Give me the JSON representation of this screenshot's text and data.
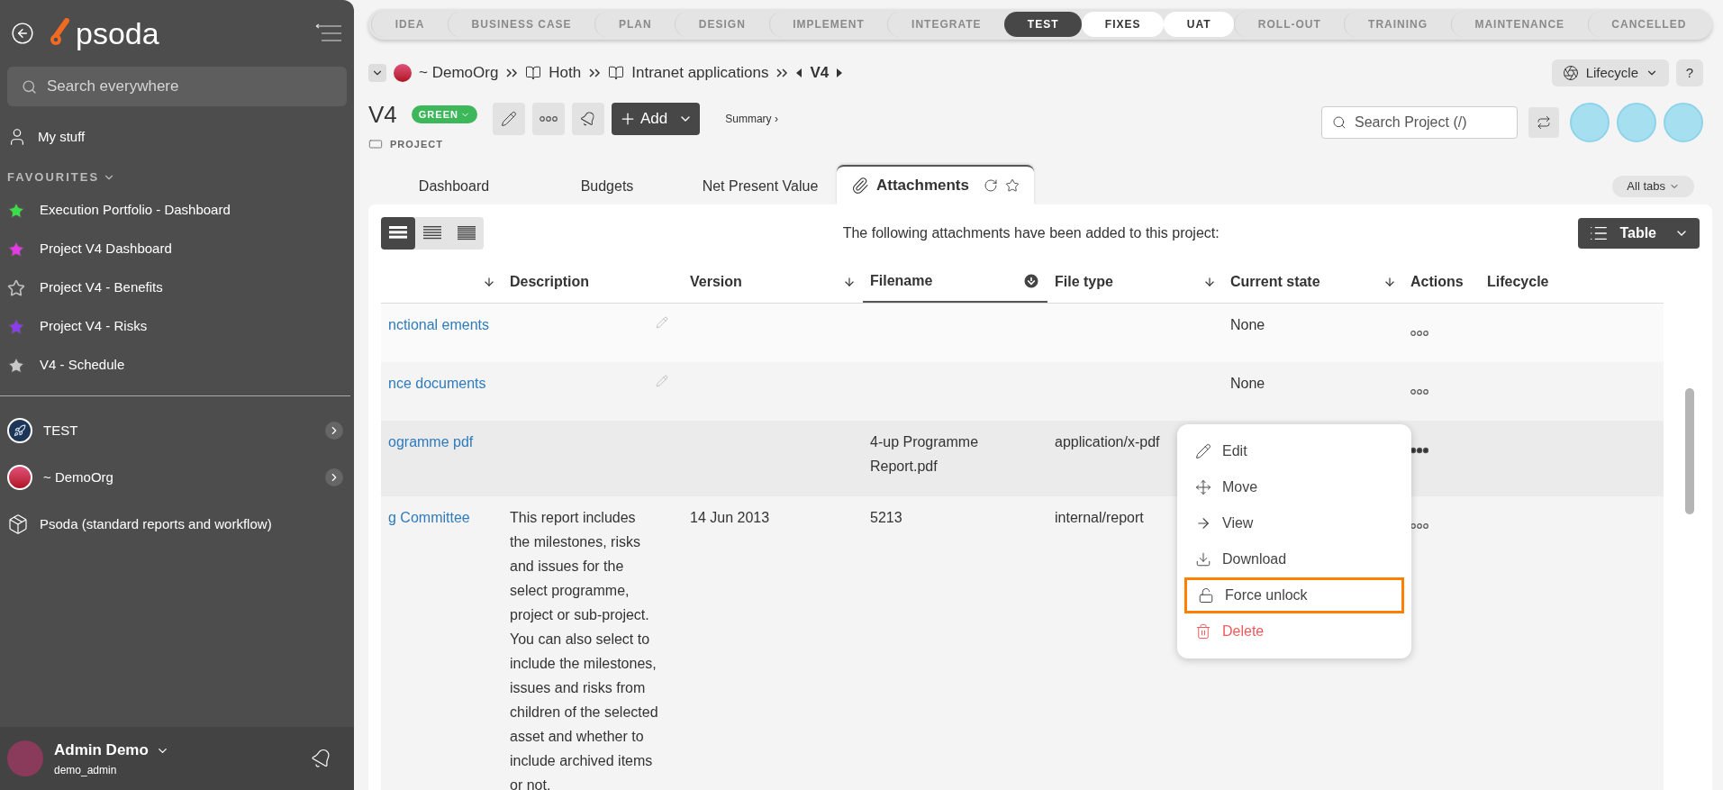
{
  "sidebar": {
    "logo": "psoda",
    "search": {
      "placeholder": "Search everywhere"
    },
    "my_stuff": "My stuff",
    "favourites_heading": "FAVOURITES",
    "favourites": [
      {
        "label": "Execution Portfolio - Dashboard",
        "color": "#3ddc4a",
        "filled": true
      },
      {
        "label": "Project V4 Dashboard",
        "color": "#e03ce0",
        "filled": true
      },
      {
        "label": "Project V4 - Benefits",
        "color": "#bdbdbd",
        "filled": false
      },
      {
        "label": "Project V4 - Risks",
        "color": "#8a3ee8",
        "filled": true
      },
      {
        "label": "V4 - Schedule",
        "color": "#c8c8c8",
        "filled": true
      }
    ],
    "items": [
      {
        "label": "TEST",
        "kind": "rocket",
        "expandable": true
      },
      {
        "label": "~ DemoOrg",
        "kind": "org",
        "expandable": true
      },
      {
        "label": "Psoda (standard reports and workflow)",
        "kind": "package",
        "expandable": false
      }
    ],
    "user": {
      "name": "Admin Demo",
      "login": "demo_admin"
    }
  },
  "stages": [
    {
      "label": "IDEA",
      "kind": "default"
    },
    {
      "label": "BUSINESS CASE",
      "kind": "default"
    },
    {
      "label": "PLAN",
      "kind": "default"
    },
    {
      "label": "DESIGN",
      "kind": "default"
    },
    {
      "label": "IMPLEMENT",
      "kind": "default"
    },
    {
      "label": "INTEGRATE",
      "kind": "default"
    },
    {
      "label": "TEST",
      "kind": "active"
    },
    {
      "label": "FIXES",
      "kind": "upcoming"
    },
    {
      "label": "UAT",
      "kind": "upcoming"
    },
    {
      "label": "ROLL-OUT",
      "kind": "default"
    },
    {
      "label": "TRAINING",
      "kind": "default"
    },
    {
      "label": "MAINTENANCE",
      "kind": "default"
    },
    {
      "label": "CANCELLED",
      "kind": "default"
    }
  ],
  "breadcrumb": [
    {
      "label": "~ DemoOrg",
      "kind": "org"
    },
    {
      "label": "Hoth",
      "kind": "book"
    },
    {
      "label": "Intranet applications",
      "kind": "book"
    }
  ],
  "current": "V4",
  "lifecycle_button": "Lifecycle",
  "help_button": "?",
  "project": {
    "title": "V4",
    "status": "GREEN",
    "type": "PROJECT",
    "add_button": "Add",
    "summary_link": "Summary ›",
    "search": {
      "placeholder": "Search Project (/)"
    }
  },
  "tabs": [
    {
      "label": "Dashboard",
      "selected": false
    },
    {
      "label": "Budgets",
      "selected": false
    },
    {
      "label": "Net Present Value",
      "selected": false
    },
    {
      "label": "Attachments",
      "selected": true
    }
  ],
  "all_tabs_button": "All tabs",
  "panel": {
    "caption": "The following attachments have been added to this project:",
    "view_button": "Table",
    "density": [
      {
        "selected": true
      },
      {
        "selected": false
      },
      {
        "selected": false
      }
    ],
    "columns": [
      {
        "sortable": true,
        "selected": false
      },
      {
        "label": "Description",
        "sortable": false,
        "selected": false
      },
      {
        "label": "Version",
        "sortable": true,
        "selected": false
      },
      {
        "label": "Filename",
        "sortable": true,
        "selected": true
      },
      {
        "label": "File type",
        "sortable": true,
        "selected": false
      },
      {
        "label": "Current state",
        "sortable": true,
        "selected": false
      },
      {
        "label": "Actions",
        "sortable": false,
        "selected": false
      },
      {
        "label": "Lifecycle",
        "sortable": false,
        "selected": false
      }
    ],
    "rows": [
      {
        "title": "nctional ements",
        "editable": true,
        "state": "None",
        "selected": false
      },
      {
        "title": "nce documents",
        "editable": true,
        "state": "None",
        "selected": false
      },
      {
        "title": "ogramme pdf",
        "editable": false,
        "filename": "4-up Programme Report.pdf",
        "file_type": "application/x-pdf",
        "selected": true
      },
      {
        "title": "g Committee",
        "description": "This report includes the milestones, risks and issues for the select programme, project or sub-project. You can also select to include the milestones, issues and risks from children of the selected asset and whether to include archived items or not.",
        "editable": false,
        "version": "14 Jun 2013",
        "filename": "5213",
        "file_type": "internal/report",
        "selected": false
      }
    ],
    "menu": [
      {
        "label": "Edit",
        "kind": "edit",
        "highlighted": false
      },
      {
        "label": "Move",
        "kind": "move",
        "highlighted": false
      },
      {
        "label": "View",
        "kind": "view",
        "highlighted": false
      },
      {
        "label": "Download",
        "kind": "download",
        "highlighted": false
      },
      {
        "label": "Force unlock",
        "kind": "unlock",
        "highlighted": true
      },
      {
        "label": "Delete",
        "kind": "delete",
        "highlighted": false
      }
    ]
  }
}
